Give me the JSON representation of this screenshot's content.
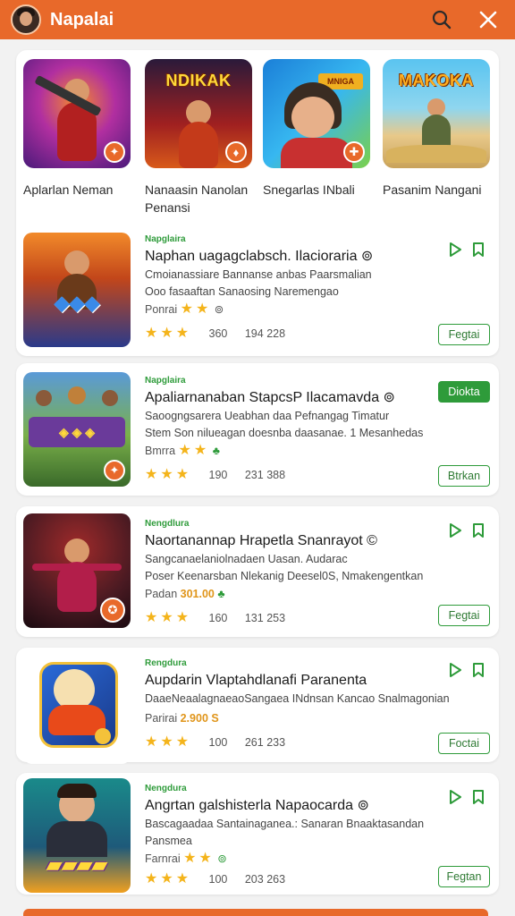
{
  "header": {
    "title": "Napalai",
    "search_icon": "search-icon",
    "close_icon": "close-icon",
    "bg": "#e8692a"
  },
  "featured": [
    {
      "label": "Aplarlan Neman",
      "bg": "#7b2aa8"
    },
    {
      "label": "Nanaasin Nanolan Penansi",
      "logo": "NDIKAK",
      "bg": "#c42424"
    },
    {
      "label": "Snegarlas INbali",
      "logo": "MNIGA",
      "bg": "#1b7fd8"
    },
    {
      "label": "Pasanim Nangani",
      "logo": "MAKOKA",
      "bg": "#3aa6d8"
    }
  ],
  "items": [
    {
      "category": "Napglaira",
      "title": "Naphan uagagclabsch. Ilacioraria ⊚",
      "desc": [
        "Cmoianassiare Bannanse anbas Paarsmalian",
        "Ooo fasaaftan Sanaosing Naremengao"
      ],
      "price_label": "Ponrai",
      "rating_note": "⊚",
      "stat1": "360",
      "stat2": "194 228",
      "button": "Fegtai"
    },
    {
      "category": "Napglaira",
      "title": "Apaliarnanaban StapcsP Ilacamavda ⊚",
      "desc": [
        "Saoogngsarera Ueabhan daa Pefnangag Timatur",
        "Stem Son nilueagan doesnba daasanae. 1 Mesanhedas"
      ],
      "price_label": "Bmrra",
      "rating_note": "♣",
      "stat1": "190",
      "stat2": "231 388",
      "badge": "Diokta",
      "button": "Btrkan"
    },
    {
      "category": "Nengdlura",
      "title": "Naortanannap Hrapetla Snanrayot ©",
      "desc": [
        "Sangcanaelaniolnadaen Uasan. Audarac",
        "Poser Keenarsban Nlekanig Deesel0S, Nmakengentkan"
      ],
      "price_label": "Padan",
      "price_value": "301.00",
      "stat1": "160",
      "stat2": "131 253",
      "button": "Fegtai"
    },
    {
      "category": "Rengdura",
      "title": "Aupdarin Vlaptahdlanafi Paranenta",
      "desc": [
        "DaaeNeaalagnaeaoSangaea INdnsan Kancao Snalmagonian"
      ],
      "price_label": "Parirai",
      "price_value": "2.900 S",
      "stat1": "100",
      "stat2": "261 233",
      "button": "Foctai"
    },
    {
      "category": "Nengdura",
      "title": "Angrtan galshisterla Napaocarda ⊚",
      "desc": [
        "Bascagaadaa Santainaganea.: Sanaran Bnaaktasandan",
        "Pansmea"
      ],
      "price_label": "Farnrai",
      "rating_note": "⊚",
      "stat1": "100",
      "stat2": "203 263",
      "button": "Fegtan"
    }
  ],
  "colors": {
    "accent": "#e8692a",
    "green": "#2e9b3a",
    "star": "#f4b41b"
  }
}
